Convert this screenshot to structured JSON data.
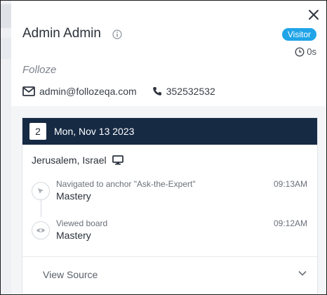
{
  "visitor": {
    "name": "Admin Admin",
    "badge": "Visitor",
    "time_on_site": "0s",
    "company": "Folloze",
    "email": "admin@follozeqa.com",
    "phone": "352532532"
  },
  "session": {
    "count": "2",
    "date": "Mon, Nov 13 2023",
    "location": "Jerusalem, Israel",
    "events": [
      {
        "description": "Navigated to anchor \"Ask-the-Expert\"",
        "title": "Mastery",
        "time": "09:13AM",
        "icon": "cursor-icon"
      },
      {
        "description": "Viewed board",
        "title": "Mastery",
        "time": "09:12AM",
        "icon": "eye-icon"
      }
    ],
    "view_source_label": "View Source"
  },
  "colors": {
    "accent": "#20a4e8",
    "session_header": "#162a44"
  }
}
